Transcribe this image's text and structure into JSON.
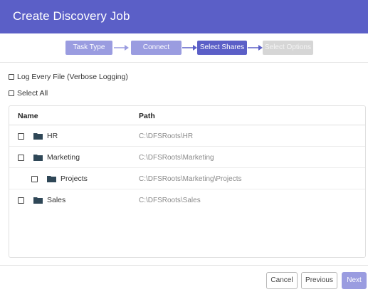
{
  "dialog": {
    "title": "Create Discovery Job"
  },
  "wizard": {
    "steps": [
      {
        "label": "Task Type",
        "state": "done"
      },
      {
        "label": "Connect",
        "state": "done"
      },
      {
        "label": "Select Shares",
        "state": "active"
      },
      {
        "label": "Select Options",
        "state": "pending"
      }
    ]
  },
  "options": {
    "verbose_label": "Log Every File (Verbose Logging)",
    "select_all_label": "Select All"
  },
  "table": {
    "columns": [
      "Name",
      "Path"
    ],
    "rows": [
      {
        "name": "HR",
        "path": "C:\\DFSRoots\\HR",
        "level": 0
      },
      {
        "name": "Marketing",
        "path": "C:\\DFSRoots\\Marketing",
        "level": 0
      },
      {
        "name": "Projects",
        "path": "C:\\DFSRoots\\Marketing\\Projects",
        "level": 1
      },
      {
        "name": "Sales",
        "path": "C:\\DFSRoots\\Sales",
        "level": 0
      }
    ]
  },
  "footer": {
    "cancel_label": "Cancel",
    "previous_label": "Previous",
    "next_label": "Next"
  },
  "colors": {
    "header": "#5b5fc7",
    "step_done": "#9a9ce0",
    "step_active": "#5b5fc7",
    "step_pending": "#d6d6d6",
    "folder_icon": "#2f4757"
  }
}
